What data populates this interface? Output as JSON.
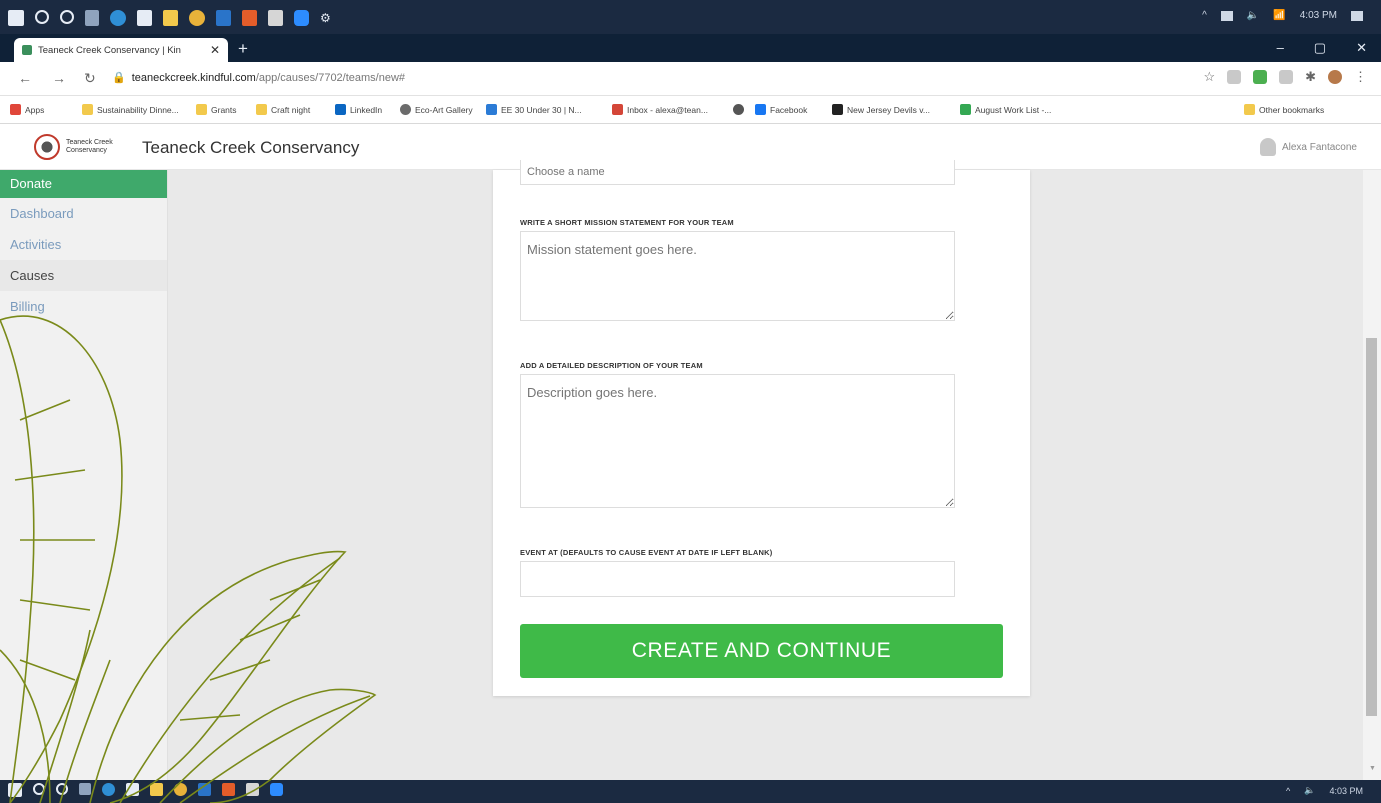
{
  "browser": {
    "tab_title": "Teaneck Creek Conservancy | Kin",
    "url_domain": "teaneckcreek.kindful.com",
    "url_path": "/app/causes/7702/teams/new#",
    "system_time": "4:03 PM"
  },
  "bookmarks": [
    "Apps",
    "Sustainability Dinne...",
    "Grants",
    "Craft night",
    "LinkedIn",
    "Eco-Art Gallery",
    "EE 30 Under 30 | N...",
    "Inbox - alexa@tean...",
    "Facebook",
    "New Jersey Devils v...",
    "August Work List -...",
    "Other bookmarks"
  ],
  "header": {
    "logo_text_line1": "Teaneck Creek",
    "logo_text_line2": "Conservancy",
    "org_name": "Teaneck Creek Conservancy",
    "user_name": "Alexa Fantacone"
  },
  "sidebar": {
    "items": [
      {
        "label": "Donate"
      },
      {
        "label": "Dashboard"
      },
      {
        "label": "Activities"
      },
      {
        "label": "Causes"
      },
      {
        "label": "Billing"
      }
    ]
  },
  "form": {
    "name_placeholder": "Choose a name",
    "mission_label": "WRITE A SHORT MISSION STATEMENT FOR YOUR TEAM",
    "mission_placeholder": "Mission statement goes here.",
    "description_label": "ADD A DETAILED DESCRIPTION OF YOUR TEAM",
    "description_placeholder": "Description goes here.",
    "event_label": "EVENT AT (DEFAULTS TO CAUSE EVENT AT DATE IF LEFT BLANK)",
    "submit_label": "CREATE AND CONTINUE"
  },
  "colors": {
    "sidebar_active": "#3fa96b",
    "cta_green": "#3fba48",
    "taskbar": "#1b2a41"
  }
}
